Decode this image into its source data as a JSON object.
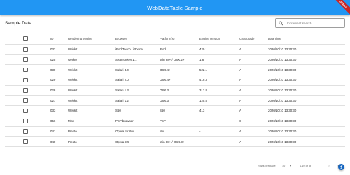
{
  "appbar": {
    "title": "WebDataTable Sample",
    "ribbon_label": "DEBUG"
  },
  "card": {
    "title": "Sample Data"
  },
  "search": {
    "placeholder": "Increment search..."
  },
  "table": {
    "sorted_column": "Browser",
    "sort_direction": "ascending",
    "headers": {
      "id": "ID",
      "engine": "Rendering engine",
      "browser": "Browser",
      "platform": "Platform(s)",
      "version": "Engine version",
      "grade": "CSS grade",
      "date": "DateTime"
    },
    "rows": [
      {
        "id": "032",
        "engine": "Webkit",
        "browser": "iPod Touch / iPhone",
        "platform": "iPod",
        "version": "420.1",
        "grade": "A",
        "date": "2020/10/10 13:30:30"
      },
      {
        "id": "025",
        "engine": "Gecko",
        "browser": "Seamonkey 1.1",
        "platform": "Win 98+ / OSX.2+",
        "version": "1.8",
        "grade": "A",
        "date": "2020/10/10 13:30:30"
      },
      {
        "id": "030",
        "engine": "Webkit",
        "browser": "Safari 3.0",
        "platform": "OSX.4+",
        "version": "522.1",
        "grade": "A",
        "date": "2020/10/10 13:30:30"
      },
      {
        "id": "029",
        "engine": "Webkit",
        "browser": "Safari 2.0",
        "platform": "OSX.4+",
        "version": "419.3",
        "grade": "A",
        "date": "2020/10/10 13:30:30"
      },
      {
        "id": "028",
        "engine": "Webkit",
        "browser": "Safari 1.3",
        "platform": "OSX.3",
        "version": "312.8",
        "grade": "A",
        "date": "2020/10/10 13:30:30"
      },
      {
        "id": "027",
        "engine": "Webkit",
        "browser": "Safari 1.2",
        "platform": "OSX.3",
        "version": "125.5",
        "grade": "A",
        "date": "2020/10/10 13:30:30"
      },
      {
        "id": "033",
        "engine": "Webkit",
        "browser": "S60",
        "platform": "S60",
        "version": "413",
        "grade": "A",
        "date": "2020/10/10 13:30:30"
      },
      {
        "id": "056",
        "engine": "Misc",
        "browser": "PSP browser",
        "platform": "PSP",
        "version": "-",
        "grade": "C",
        "date": "2020/10/10 13:30:30"
      },
      {
        "id": "041",
        "engine": "Presto",
        "browser": "Opera for Wii",
        "platform": "Wii",
        "version": "-",
        "grade": "A",
        "date": "2020/10/10 13:30:30"
      },
      {
        "id": "040",
        "engine": "Presto",
        "browser": "Opera 9.5",
        "platform": "Win 88+ / OSX.3+",
        "version": "-",
        "grade": "A",
        "date": "2020/10/10 13:30:30"
      }
    ]
  },
  "pagination": {
    "rows_per_page_label": "Rows per page:",
    "rows_per_page_value": "10",
    "range_text": "1-10 of 56"
  },
  "colors": {
    "appbar": "#2196f3",
    "ribbon": "#c62828",
    "fab": "#1565c0"
  },
  "icons": {
    "search": "search-icon",
    "sort": "arrow-up-icon",
    "prev": "chevron-left-icon",
    "next": "chevron-right-icon",
    "fab": "flutter-icon"
  }
}
